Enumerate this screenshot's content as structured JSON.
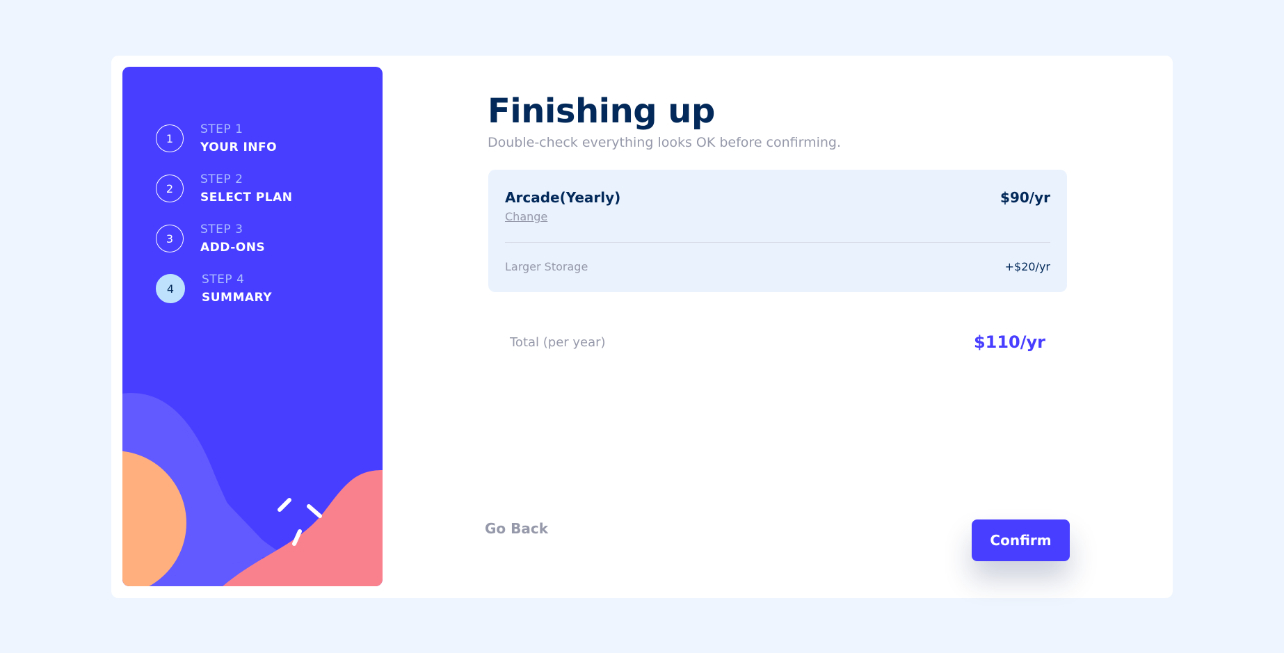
{
  "steps": [
    {
      "number": "1",
      "label": "STEP 1",
      "title": "YOUR INFO",
      "active": false
    },
    {
      "number": "2",
      "label": "STEP 2",
      "title": "SELECT PLAN",
      "active": false
    },
    {
      "number": "3",
      "label": "STEP 3",
      "title": "ADD-ONS",
      "active": false
    },
    {
      "number": "4",
      "label": "STEP 4",
      "title": "SUMMARY",
      "active": true
    }
  ],
  "main": {
    "heading": "Finishing up",
    "subheading": "Double-check everything looks OK before confirming."
  },
  "summary": {
    "plan_name": "Arcade(Yearly)",
    "plan_price": "$90/yr",
    "change_label": "Change",
    "addons": [
      {
        "name": "Larger Storage",
        "price": "+$20/yr"
      }
    ]
  },
  "total": {
    "label": "Total (per year)",
    "price": "$110/yr"
  },
  "buttons": {
    "back_label": "Go Back",
    "confirm_label": "Confirm"
  },
  "colors": {
    "sidebar": "#483eff",
    "accent": "#483eff",
    "heading": "#022959",
    "muted": "#9699aa",
    "active_step": "#bee2fd",
    "summary_bg": "#eaf2fd",
    "decor_orange": "#ffaf7e",
    "decor_pink": "#f9818e",
    "decor_purple": "#6259ff"
  }
}
